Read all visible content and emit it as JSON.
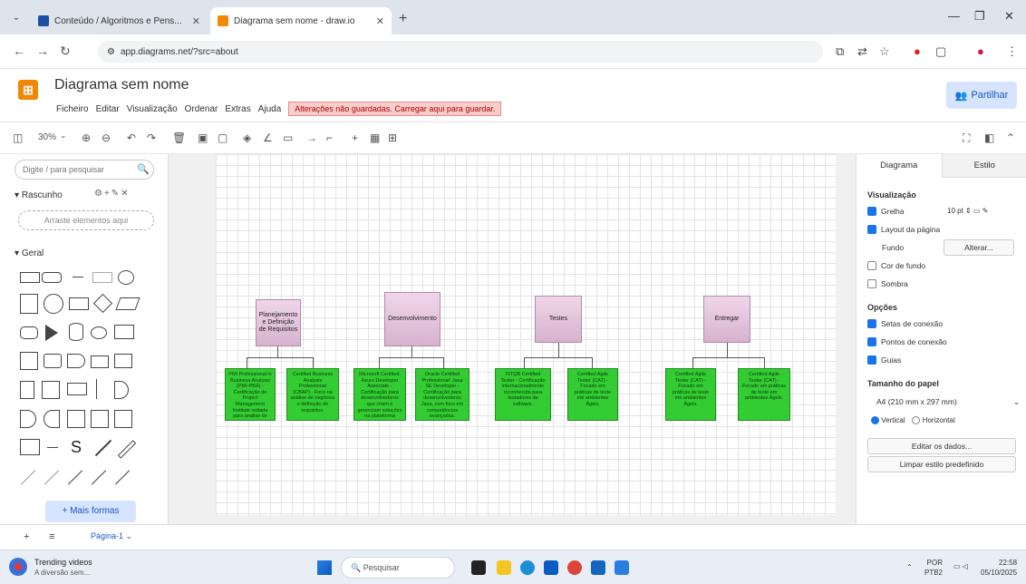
{
  "browser": {
    "tabs": [
      {
        "title": "Conteúdo / Algoritmos e Pens..."
      },
      {
        "title": "Diagrama sem nome - draw.io"
      }
    ],
    "url": "app.diagrams.net/?src=about"
  },
  "app": {
    "title": "Diagrama sem nome",
    "menu": [
      "Ficheiro",
      "Editar",
      "Visualização",
      "Ordenar",
      "Extras",
      "Ajuda"
    ],
    "warning": "Alterações não guardadas. Carregar aqui para guardar.",
    "share_label": "Partilhar",
    "zoom": "30%"
  },
  "sidebar": {
    "search_placeholder": "Digite / para pesquisar",
    "scratchpad_label": "Rascunho",
    "drop_hint": "Arraste elementos aqui",
    "general_label": "Geral",
    "more_shapes": "+ Mais formas"
  },
  "diagram": {
    "headers": [
      {
        "label": "Planejamento e Definição de Requisitos"
      },
      {
        "label": "Desenvolvimento"
      },
      {
        "label": "Testes"
      },
      {
        "label": "Entregar"
      }
    ],
    "cards": [
      {
        "text": "PMI Professional in Business Analysis (PMI-PBA) - Certificação de Project Management Institute voltada para análise de requisitos."
      },
      {
        "text": "Certified Business Analysis Professional (CBAP) - Foco na análise de negócios e definição de requisitos."
      },
      {
        "text": "Microsoft Certified: Azure Developer Associate - Certificação para desenvolvedores que criam e gerenciam soluções na plataforma Azure."
      },
      {
        "text": "Oracle Certified Professional: Java SE Developer - Certificação para desenvolvedores Java, com foco em competências avançadas."
      },
      {
        "text": "ISTQB Certified Tester - Certificação internacionalmente reconhecida para testadores de software."
      },
      {
        "text": "Certified Agile Tester (CAT) - Focado em práticas de teste em ambientes Ágeis."
      },
      {
        "text": "Certified Agile Tester (CAT) - Focado em práticas de teste em ambientes Ágeis."
      },
      {
        "text": "Certified Agile Tester (CAT) - Focado em práticas de teste em ambientes Ágeis."
      }
    ]
  },
  "right_panel": {
    "tabs": [
      "Diagrama",
      "Estilo"
    ],
    "view_title": "Visualização",
    "grid": "Grelha",
    "grid_size": "10 pt",
    "page_layout": "Layout da página",
    "background": "Fundo",
    "change": "Alterar...",
    "bg_color": "Cor de fundo",
    "shadow": "Sombra",
    "options_title": "Opções",
    "conn_arrows": "Setas de conexão",
    "conn_points": "Pontos de conexão",
    "guides": "Guias",
    "paper_title": "Tamanho do papel",
    "paper_size": "A4 (210 mm x 297 mm)",
    "vertical": "Vertical",
    "horizontal": "Horizontal",
    "edit_data": "Editar os dados...",
    "clear_style": "Limpar estilo predefinido"
  },
  "pages": {
    "current": "Página-1"
  },
  "taskbar": {
    "news_title": "Trending videos",
    "news_sub": "A diversão sem...",
    "search": "Pesquisar",
    "lang": "POR",
    "lang2": "PTB2",
    "time": "22:58",
    "date": "05/10/2025"
  }
}
